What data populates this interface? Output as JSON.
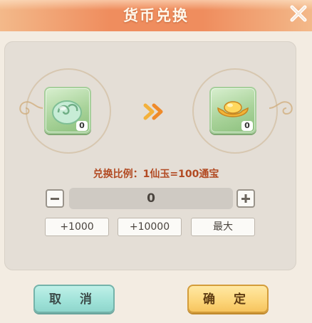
{
  "dialog": {
    "title": "货币兑换",
    "ratio_text": "兑换比例：1仙玉=100通宝"
  },
  "source_item": {
    "icon": "jade-currency-icon",
    "count": "0"
  },
  "target_item": {
    "icon": "gold-ingot-icon",
    "count": "0"
  },
  "amount": {
    "value": "0"
  },
  "quick_buttons": [
    {
      "label": "+1000"
    },
    {
      "label": "+10000"
    },
    {
      "label": "最大"
    }
  ],
  "actions": {
    "cancel_label": "取 消",
    "confirm_label": "确 定"
  },
  "colors": {
    "header": "#ef8d5e",
    "ratio_text": "#b24a22",
    "cancel": "#9fe2d8",
    "confirm": "#fcd57a"
  }
}
